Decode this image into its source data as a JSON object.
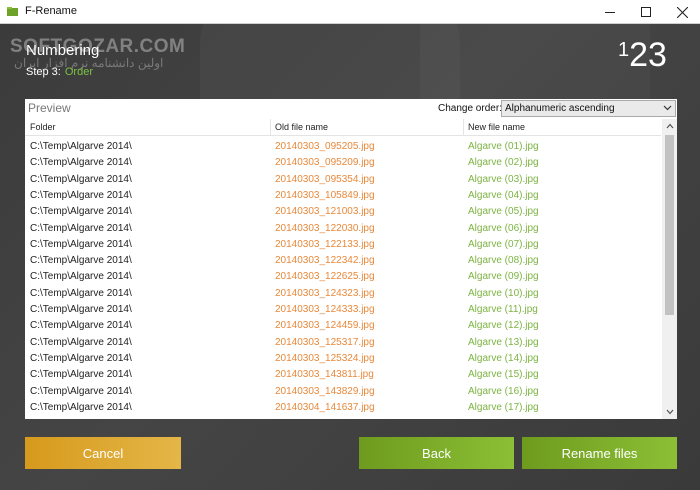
{
  "window": {
    "title": "F-Rename",
    "icon": "folder-icon",
    "controls": [
      "minimize-icon",
      "maximize-icon",
      "close-icon"
    ]
  },
  "header": {
    "title": "Numbering",
    "step_label": "Step 3:",
    "step_value": "Order",
    "logo_small": "1",
    "logo_large": "23",
    "accent_color": "#7dc242"
  },
  "watermark": {
    "brand": "SOFTGOZAR.COM",
    "subtitle": "اولین دانشنامه نرم افزار ایران"
  },
  "preview": {
    "label": "Preview",
    "order_label": "Change order:",
    "order_value": "Alphanumeric ascending",
    "columns": [
      "Folder",
      "Old file name",
      "New file name"
    ],
    "rows": [
      {
        "folder": "C:\\Temp\\Algarve 2014\\",
        "old": "20140303_095205.jpg",
        "new": "Algarve (01).jpg"
      },
      {
        "folder": "C:\\Temp\\Algarve 2014\\",
        "old": "20140303_095209.jpg",
        "new": "Algarve (02).jpg"
      },
      {
        "folder": "C:\\Temp\\Algarve 2014\\",
        "old": "20140303_095354.jpg",
        "new": "Algarve (03).jpg"
      },
      {
        "folder": "C:\\Temp\\Algarve 2014\\",
        "old": "20140303_105849.jpg",
        "new": "Algarve (04).jpg"
      },
      {
        "folder": "C:\\Temp\\Algarve 2014\\",
        "old": "20140303_121003.jpg",
        "new": "Algarve (05).jpg"
      },
      {
        "folder": "C:\\Temp\\Algarve 2014\\",
        "old": "20140303_122030.jpg",
        "new": "Algarve (06).jpg"
      },
      {
        "folder": "C:\\Temp\\Algarve 2014\\",
        "old": "20140303_122133.jpg",
        "new": "Algarve (07).jpg"
      },
      {
        "folder": "C:\\Temp\\Algarve 2014\\",
        "old": "20140303_122342.jpg",
        "new": "Algarve (08).jpg"
      },
      {
        "folder": "C:\\Temp\\Algarve 2014\\",
        "old": "20140303_122625.jpg",
        "new": "Algarve (09).jpg"
      },
      {
        "folder": "C:\\Temp\\Algarve 2014\\",
        "old": "20140303_124323.jpg",
        "new": "Algarve (10).jpg"
      },
      {
        "folder": "C:\\Temp\\Algarve 2014\\",
        "old": "20140303_124333.jpg",
        "new": "Algarve (11).jpg"
      },
      {
        "folder": "C:\\Temp\\Algarve 2014\\",
        "old": "20140303_124459.jpg",
        "new": "Algarve (12).jpg"
      },
      {
        "folder": "C:\\Temp\\Algarve 2014\\",
        "old": "20140303_125317.jpg",
        "new": "Algarve (13).jpg"
      },
      {
        "folder": "C:\\Temp\\Algarve 2014\\",
        "old": "20140303_125324.jpg",
        "new": "Algarve (14).jpg"
      },
      {
        "folder": "C:\\Temp\\Algarve 2014\\",
        "old": "20140303_143811.jpg",
        "new": "Algarve (15).jpg"
      },
      {
        "folder": "C:\\Temp\\Algarve 2014\\",
        "old": "20140303_143829.jpg",
        "new": "Algarve (16).jpg"
      },
      {
        "folder": "C:\\Temp\\Algarve 2014\\",
        "old": "20140304_141637.jpg",
        "new": "Algarve (17).jpg"
      }
    ],
    "old_name_color": "#e8883a",
    "new_name_color": "#7cb342"
  },
  "buttons": {
    "cancel": "Cancel",
    "back": "Back",
    "rename": "Rename files",
    "cancel_color": "#d69a1c",
    "action_color": "#7cb342"
  }
}
